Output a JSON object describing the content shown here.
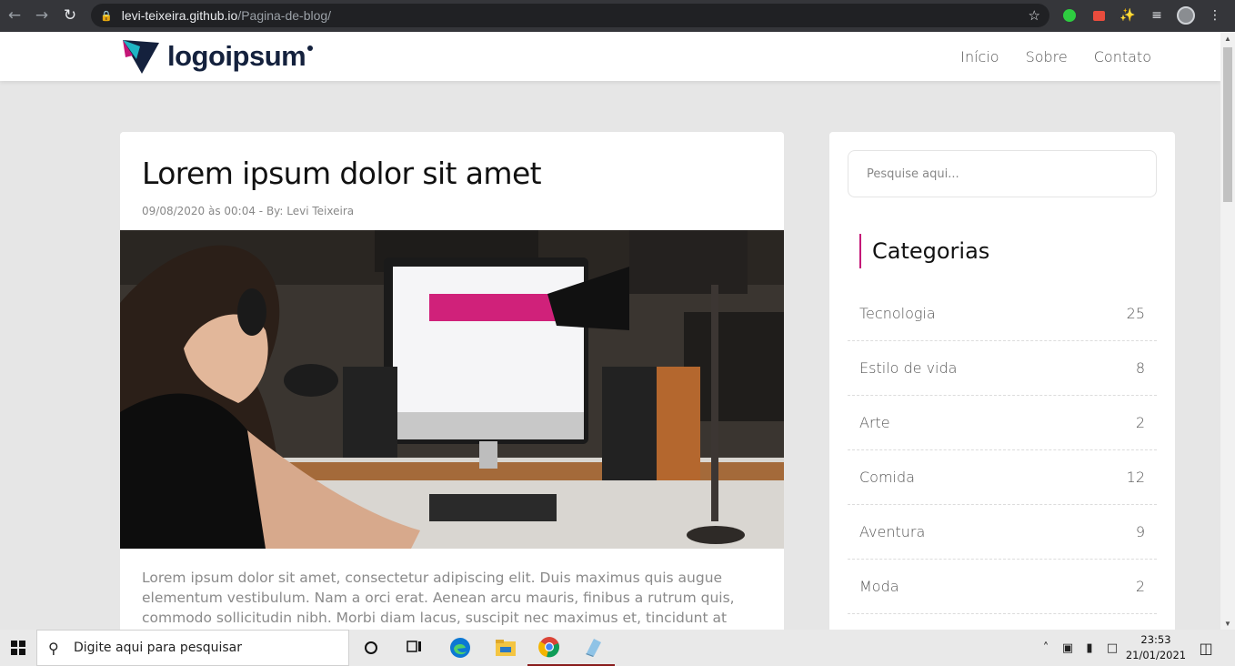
{
  "browser": {
    "url_host": "levi-teixeira.github.io",
    "url_path": "/Pagina-de-blog/",
    "back_icon": "arrow-left",
    "forward_icon": "arrow-right",
    "reload_icon": "reload",
    "star_icon": "star"
  },
  "site": {
    "logo_text": "logoipsum",
    "nav": [
      "Início",
      "Sobre",
      "Contato"
    ]
  },
  "article": {
    "title": "Lorem ipsum dolor sit amet",
    "meta": "09/08/2020 às 00:04 - By: Levi Teixeira",
    "excerpt": "Lorem ipsum dolor sit amet, consectetur adipiscing elit. Duis maximus quis augue elementum vestibulum. Nam a orci erat. Aenean arcu mauris, finibus a rutrum quis, commodo sollicitudin nibh. Morbi diam lacus, suscipit nec maximus et, tincidunt at quam."
  },
  "sidebar": {
    "search_placeholder": "Pesquise aqui...",
    "categories_title": "Categorias",
    "categories": [
      {
        "name": "Tecnologia",
        "count": "25"
      },
      {
        "name": "Estilo de vida",
        "count": "8"
      },
      {
        "name": "Arte",
        "count": "2"
      },
      {
        "name": "Comida",
        "count": "12"
      },
      {
        "name": "Aventura",
        "count": "9"
      },
      {
        "name": "Moda",
        "count": "2"
      }
    ]
  },
  "taskbar": {
    "search_placeholder": "Digite aqui para pesquisar",
    "time": "23:53",
    "date": "21/01/2021"
  },
  "colors": {
    "accent": "#c41677",
    "logo_navy": "#14213d",
    "logo_teal": "#1fb5c4"
  }
}
